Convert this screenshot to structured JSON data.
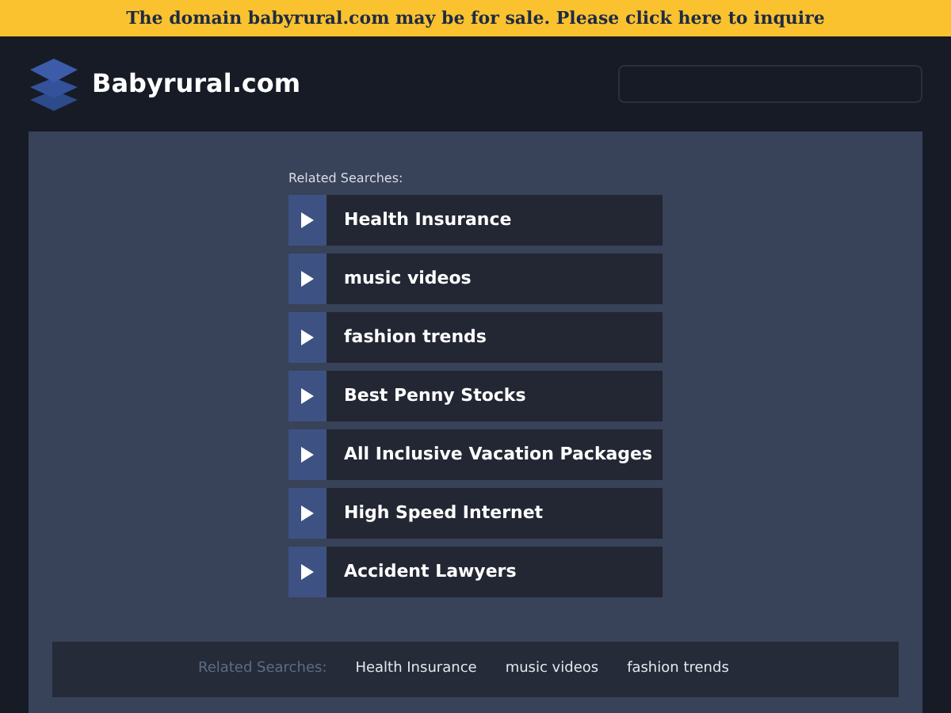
{
  "banner": {
    "text": "The domain babyrural.com may be for sale. Please click here to inquire"
  },
  "header": {
    "site_name": "Babyrural.com"
  },
  "related": {
    "heading": "Related Searches:",
    "links": [
      "Health Insurance",
      "music videos",
      "fashion trends",
      "Best Penny Stocks",
      "All Inclusive Vacation Packages",
      "High Speed Internet",
      "Accident Lawyers"
    ]
  },
  "footer": {
    "heading": "Related Searches:",
    "links": [
      "Health Insurance",
      "music videos",
      "fashion trends"
    ]
  }
}
